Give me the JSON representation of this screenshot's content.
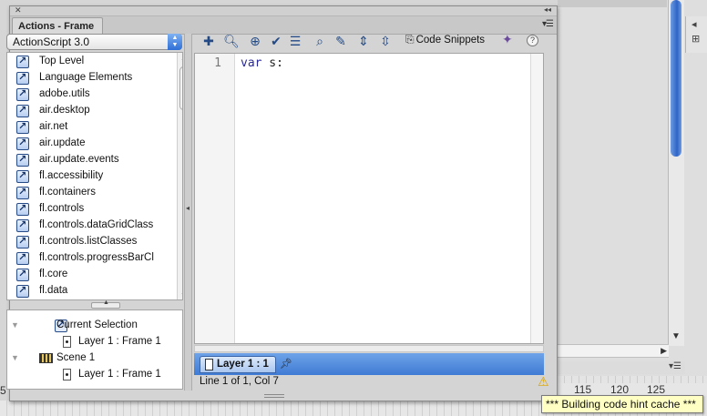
{
  "panel": {
    "tab_label": "Actions - Frame",
    "menu_glyph": "▾☰",
    "close_glyph": "✕",
    "collapse_glyph": "◂◂"
  },
  "language_select": {
    "value": "ActionScript 3.0"
  },
  "toolbox": {
    "items": [
      {
        "label": "Top Level"
      },
      {
        "label": "Language Elements"
      },
      {
        "label": "adobe.utils"
      },
      {
        "label": "air.desktop"
      },
      {
        "label": "air.net"
      },
      {
        "label": "air.update"
      },
      {
        "label": "air.update.events"
      },
      {
        "label": "fl.accessibility"
      },
      {
        "label": "fl.containers"
      },
      {
        "label": "fl.controls"
      },
      {
        "label": "fl.controls.dataGridClass"
      },
      {
        "label": "fl.controls.listClasses"
      },
      {
        "label": "fl.controls.progressBarCl"
      },
      {
        "label": "fl.core"
      },
      {
        "label": "fl.data"
      }
    ]
  },
  "navigator": {
    "current_selection": "Current Selection",
    "current_frame": "Layer 1 : Frame 1",
    "scene": "Scene 1",
    "scene_frame": "Layer 1 : Frame 1"
  },
  "toolbar": {
    "code_snippets_label": "Code Snippets",
    "help_glyph": "?"
  },
  "editor": {
    "line_number": "1",
    "keyword": "var",
    "code_rest": " s:"
  },
  "script_tab": {
    "label": "Layer 1 : 1"
  },
  "status": {
    "text": "Line 1 of 1, Col 7"
  },
  "tooltip": {
    "text": "*** Building code hint cache ***"
  },
  "timeline": {
    "ruler_numbers": [
      "115",
      "120",
      "125"
    ],
    "left_number": "5"
  },
  "colors": {
    "accent": "#2f6fd6",
    "keyword": "#2a2a9a",
    "tooltip_bg": "#ffffc4"
  }
}
